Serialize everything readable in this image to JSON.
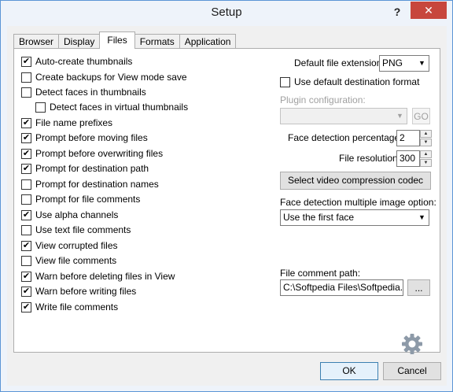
{
  "window": {
    "title": "Setup",
    "help_glyph": "?",
    "close_glyph": "✕"
  },
  "tabs": [
    {
      "label": "Browser",
      "active": false
    },
    {
      "label": "Display",
      "active": false
    },
    {
      "label": "Files",
      "active": true
    },
    {
      "label": "Formats",
      "active": false
    },
    {
      "label": "Application",
      "active": false
    }
  ],
  "checkboxes": [
    {
      "label": "Auto-create thumbnails",
      "checked": true
    },
    {
      "label": "Create backups for View mode save",
      "checked": false
    },
    {
      "label": "Detect faces in thumbnails",
      "checked": false
    },
    {
      "label": "Detect faces in virtual thumbnails",
      "checked": false
    },
    {
      "label": "File name prefixes",
      "checked": true
    },
    {
      "label": "Prompt before moving files",
      "checked": true
    },
    {
      "label": "Prompt before overwriting files",
      "checked": true
    },
    {
      "label": "Prompt for destination path",
      "checked": true
    },
    {
      "label": "Prompt for destination names",
      "checked": false
    },
    {
      "label": "Prompt for file comments",
      "checked": false
    },
    {
      "label": "Use alpha channels",
      "checked": true
    },
    {
      "label": "Use text file comments",
      "checked": false
    },
    {
      "label": "View corrupted files",
      "checked": true
    },
    {
      "label": "View file comments",
      "checked": false
    },
    {
      "label": "Warn before deleting files in View",
      "checked": true
    },
    {
      "label": "Warn before writing files",
      "checked": true
    },
    {
      "label": "Write file comments",
      "checked": true
    }
  ],
  "right": {
    "default_ext_label": "Default file extension:",
    "default_ext_value": "PNG",
    "use_default_dest_label": "Use default destination format",
    "use_default_dest_checked": false,
    "plugin_config_label": "Plugin configuration:",
    "plugin_config_value": "",
    "go_label": "GO",
    "face_pct_label": "Face detection percentage:",
    "face_pct_value": "2",
    "file_res_label": "File resolution:",
    "file_res_value": "300",
    "select_codec_label": "Select video compression codec",
    "face_multi_label": "Face detection multiple image option:",
    "face_multi_value": "Use the first face",
    "comment_path_label": "File comment path:",
    "comment_path_value": "C:\\Softpedia Files\\Softpedia.txt",
    "browse_label": "..."
  },
  "footer": {
    "ok_label": "OK",
    "cancel_label": "Cancel"
  },
  "icons": {
    "gear": "gear-icon",
    "arrow_down": "▼",
    "spin_up": "▲",
    "spin_down": "▼"
  }
}
